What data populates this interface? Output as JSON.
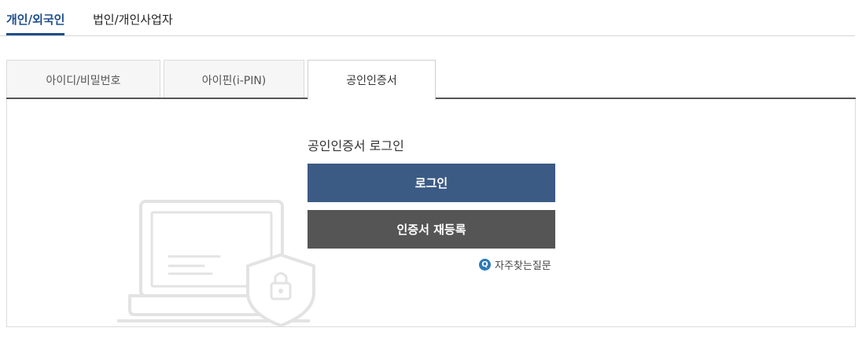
{
  "top_tabs": [
    {
      "label": "개인/외국인",
      "active": true
    },
    {
      "label": "법인/개인사업자",
      "active": false
    }
  ],
  "login_tabs": [
    {
      "label": "아이디/비밀번호",
      "active": false
    },
    {
      "label": "아이핀(i-PIN)",
      "active": false
    },
    {
      "label": "공인인증서",
      "active": true
    }
  ],
  "cert_login": {
    "title": "공인인증서 로그인",
    "login_button": "로그인",
    "reregister_button": "인증서 재등록",
    "faq_link": "자주찾는질문",
    "faq_icon": "Q"
  },
  "colors": {
    "accent": "#1f4e8c",
    "login_button": "#3b5b85",
    "reregister_button": "#555555",
    "faq_icon": "#2a79b5"
  }
}
